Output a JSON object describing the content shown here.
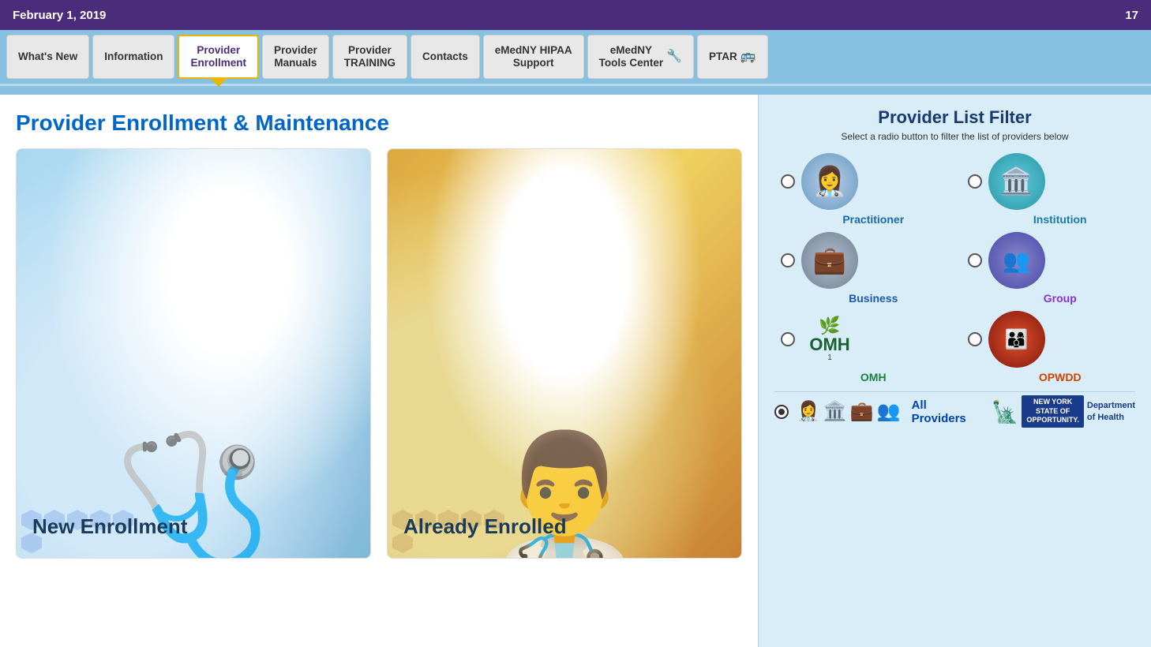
{
  "topbar": {
    "date": "February 1, 2019",
    "page_number": "17"
  },
  "nav": {
    "items": [
      {
        "id": "whats-new",
        "label": "What's New",
        "active": false
      },
      {
        "id": "information",
        "label": "Information",
        "active": false
      },
      {
        "id": "provider-enrollment",
        "label": "Provider\nEnrollment",
        "active": true
      },
      {
        "id": "provider-manuals",
        "label": "Provider\nManuals",
        "active": false
      },
      {
        "id": "provider-training",
        "label": "Provider\nTRAINING",
        "active": false
      },
      {
        "id": "contacts",
        "label": "Contacts",
        "active": false
      },
      {
        "id": "emedny-hipaa",
        "label": "eMedNY HIPAA\nSupport",
        "active": false
      },
      {
        "id": "emedny-tools",
        "label": "eMedNY\nTools Center",
        "active": false
      },
      {
        "id": "ptar",
        "label": "PTAR",
        "active": false
      }
    ]
  },
  "main": {
    "page_title": "Provider Enrollment & Maintenance",
    "cards": [
      {
        "id": "new-enrollment",
        "label": "New Enrollment",
        "style": "blue"
      },
      {
        "id": "already-enrolled",
        "label": "Already Enrolled",
        "style": "gold"
      }
    ]
  },
  "filter": {
    "title": "Provider List Filter",
    "subtitle": "Select a radio button to filter the list of providers below",
    "options": [
      {
        "id": "practitioner",
        "label": "Practitioner",
        "icon": "👩‍⚕️",
        "selected": false,
        "color": "blue"
      },
      {
        "id": "institution",
        "label": "Institution",
        "icon": "🏛️",
        "selected": false,
        "color": "teal"
      },
      {
        "id": "business",
        "label": "Business",
        "icon": "💼",
        "selected": false,
        "color": "gray"
      },
      {
        "id": "group",
        "label": "Group",
        "icon": "👥",
        "selected": false,
        "color": "purple"
      },
      {
        "id": "omh",
        "label": "OMH",
        "selected": false,
        "color": "green"
      },
      {
        "id": "opwdd",
        "label": "OPWDD",
        "icon": "👨‍👩‍👦",
        "selected": false,
        "color": "orange"
      }
    ],
    "all_providers": {
      "label": "All Providers",
      "selected": true
    },
    "ny_logo": {
      "line1": "NEW YORK",
      "line2": "STATE OF",
      "line3": "OPPORTUNITY.",
      "dept": "Department\nof Health"
    }
  }
}
